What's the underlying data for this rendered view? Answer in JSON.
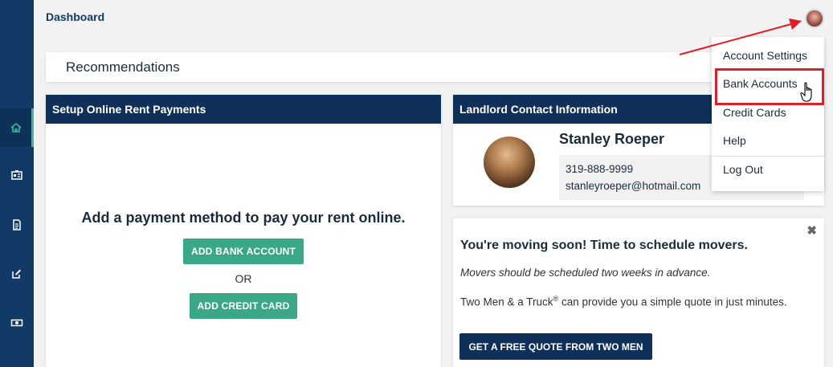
{
  "header": {
    "title": "Dashboard"
  },
  "recommendations": {
    "title": "Recommendations"
  },
  "setup_card": {
    "title": "Setup Online Rent Payments",
    "prompt": "Add a payment method to pay your rent online.",
    "add_bank_label": "ADD BANK ACCOUNT",
    "or_label": "OR",
    "add_card_label": "ADD CREDIT CARD"
  },
  "landlord_card": {
    "title": "Landlord Contact Information",
    "name": "Stanley Roeper",
    "phone": "319-888-9999",
    "email": "stanleyroeper@hotmail.com"
  },
  "movers_card": {
    "close": "✖",
    "title": "You're moving soon! Time to schedule movers.",
    "note": "Movers should be scheduled two weeks in advance.",
    "body_prefix": "Two Men & a Truck",
    "body_sup": "®",
    "body_suffix": " can provide you a simple quote in just minutes.",
    "cta_label": "GET A FREE QUOTE FROM TWO MEN"
  },
  "user_menu": {
    "items": [
      {
        "label": "Account Settings"
      },
      {
        "label": "Bank Accounts",
        "highlighted": true
      },
      {
        "label": "Credit Cards"
      },
      {
        "label": "Help"
      },
      {
        "label": "Log Out"
      }
    ]
  },
  "sidebar": {
    "items": [
      {
        "icon": "home-icon",
        "active": true
      },
      {
        "icon": "id-card-icon"
      },
      {
        "icon": "document-icon"
      },
      {
        "icon": "edit-icon"
      },
      {
        "icon": "money-icon"
      }
    ]
  },
  "colors": {
    "sidebar": "#113a66",
    "card_header": "#0f3058",
    "green_button": "#3aa789",
    "highlight": "#e01e26",
    "active_accent": "#3fb893"
  }
}
